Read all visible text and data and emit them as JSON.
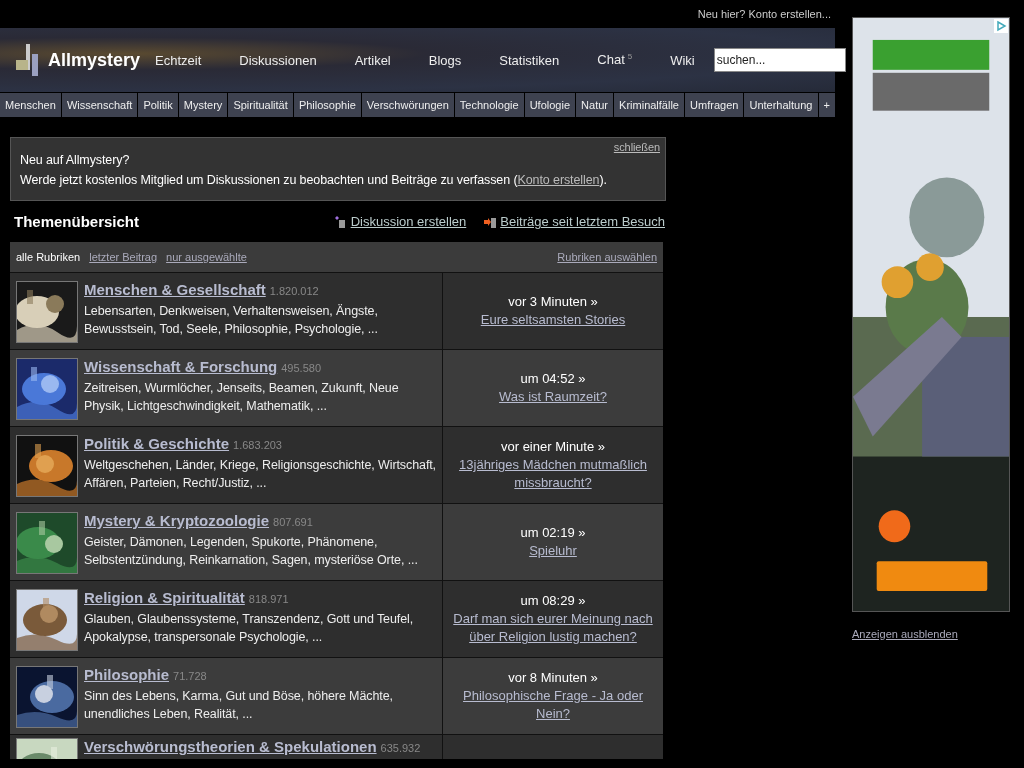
{
  "top_bar": {
    "signup_link": "Neu hier? Konto erstellen..."
  },
  "header": {
    "logo": "Allmystery",
    "nav": [
      {
        "label": "Echtzeit"
      },
      {
        "label": "Diskussionen"
      },
      {
        "label": "Artikel"
      },
      {
        "label": "Blogs"
      },
      {
        "label": "Statistiken"
      },
      {
        "label": "Chat",
        "badge": "5"
      },
      {
        "label": "Wiki"
      }
    ],
    "search": {
      "placeholder": "suchen..."
    }
  },
  "categories": [
    "Menschen",
    "Wissenschaft",
    "Politik",
    "Mystery",
    "Spiritualität",
    "Philosophie",
    "Verschwörungen",
    "Technologie",
    "Ufologie",
    "Natur",
    "Kriminalfälle",
    "Umfragen",
    "Unterhaltung",
    "+"
  ],
  "notice": {
    "close": "schließen",
    "title": "Neu auf Allmystery?",
    "text": "Werde jetzt kostenlos Mitglied um Diskussionen zu beobachten und Beiträge zu verfassen (",
    "link": "Konto erstellen",
    "text_end": ")."
  },
  "overview": {
    "title": "Themenübersicht",
    "actions": [
      {
        "label": "Diskussion erstellen",
        "kind": "create"
      },
      {
        "label": "Beiträge seit letztem Besuch",
        "kind": "new"
      }
    ]
  },
  "table": {
    "filters": [
      {
        "label": "alle Rubriken",
        "selected": true
      },
      {
        "label": "letzter Beitrag",
        "selected": false
      },
      {
        "label": "nur ausgewählte",
        "selected": false
      }
    ],
    "select_link": "Rubriken auswählen",
    "rows": [
      {
        "title": "Menschen & Gesellschaft",
        "count": "1.820.012",
        "topics": "Lebensarten, Denkweisen, Verhaltensweisen, Ängste, Bewusstsein, Tod, Seele, Philosophie, Psychologie, ...",
        "last_time": "vor 3 Minuten »",
        "last_thread": "Eure seltsamsten Stories"
      },
      {
        "title": "Wissenschaft & Forschung",
        "count": "495.580",
        "topics": "Zeitreisen, Wurmlöcher, Jenseits, Beamen, Zukunft, Neue Physik, Lichtgeschwindigkeit, Mathematik, ...",
        "last_time": "um 04:52 »",
        "last_thread": "Was ist Raumzeit?"
      },
      {
        "title": "Politik & Geschichte",
        "count": "1.683.203",
        "topics": "Weltgeschehen, Länder, Kriege, Religionsgeschichte, Wirtschaft, Affären, Parteien, Recht/Justiz, ...",
        "last_time": "vor einer Minute »",
        "last_thread": "13jähriges Mädchen mutmaßlich missbraucht?"
      },
      {
        "title": "Mystery & Kryptozoologie",
        "count": "807.691",
        "topics": "Geister, Dämonen, Legenden, Spukorte, Phänomene, Selbstentzündung, Reinkarnation, Sagen, mysteriöse Orte, ...",
        "last_time": "um 02:19 »",
        "last_thread": "Spieluhr"
      },
      {
        "title": "Religion & Spiritualität",
        "count": "818.971",
        "topics": "Glauben, Glaubenssysteme, Transzendenz, Gott und Teufel, Apokalypse, transpersonale Psychologie, ...",
        "last_time": "um 08:29 »",
        "last_thread": "Darf man sich eurer Meinung nach über Religion lustig machen?"
      },
      {
        "title": "Philosophie",
        "count": "71.728",
        "topics": "Sinn des Lebens, Karma, Gut und Böse, höhere Mächte, unendliches Leben, Realität, ...",
        "last_time": "vor 8 Minuten »",
        "last_thread": "Philosophische Frage - Ja oder Nein?"
      },
      {
        "title": "Verschwörungstheorien & Spekulationen",
        "count": "635.932"
      }
    ]
  },
  "sidebar": {
    "hide_ads": "Anzeigen ausblenden"
  }
}
